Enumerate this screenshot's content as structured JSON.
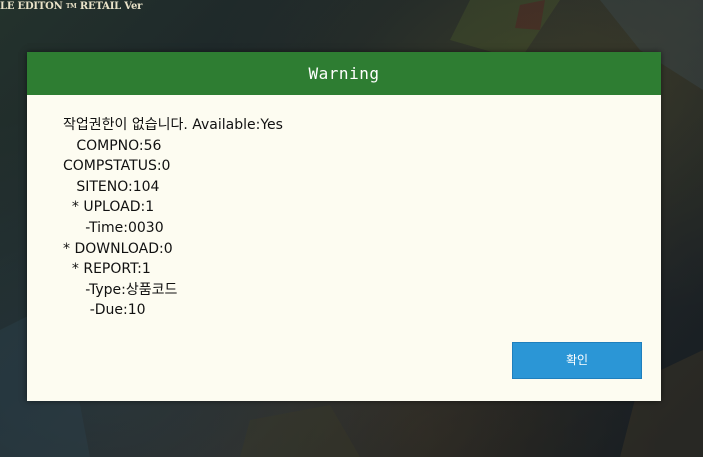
{
  "background": {
    "title_main": "LE EDITON",
    "title_tm": "TM",
    "title_suffix": "RETAIL Ver"
  },
  "dialog": {
    "title": "Warning",
    "message_lines": [
      "작업권한이 없습니다. Available:Yes",
      "   COMPNO:56",
      "COMPSTATUS:0",
      "   SITENO:104",
      "  * UPLOAD:1",
      "     -Time:0030",
      "* DOWNLOAD:0",
      "  * REPORT:1",
      "     -Type:상품코드",
      "      -Due:10"
    ],
    "confirm_label": "확인"
  },
  "colors": {
    "header_bg": "#2e7d32",
    "dialog_bg": "#fdfcf1",
    "button_bg": "#2b96d6"
  }
}
